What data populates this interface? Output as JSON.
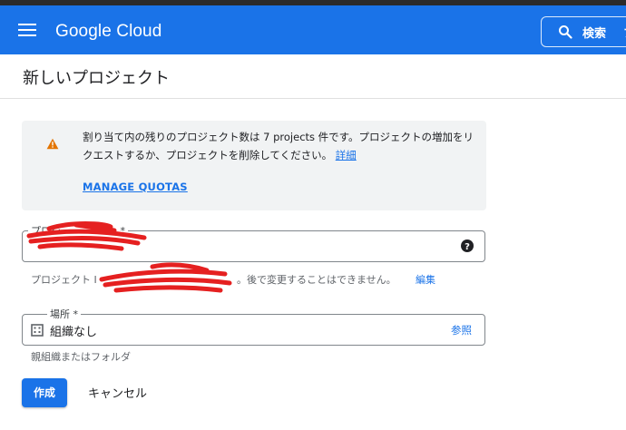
{
  "header": {
    "brand": "Google Cloud",
    "search_label": "検索",
    "search_overflow": "プ"
  },
  "page": {
    "title": "新しいプロジェクト"
  },
  "notice": {
    "message": "割り当て内の残りのプロジェクト数は 7 projects 件です。プロジェクトの増加をリクエストするか、プロジェクトを削除してください。",
    "details_link": "詳細",
    "manage_quotas": "MANAGE QUOTAS"
  },
  "project_name": {
    "label": "プロジ",
    "label_suffix": "*"
  },
  "project_id": {
    "hint_prefix": "プロジェクト I",
    "hint_suffix": "。後で変更することはできません。",
    "edit_label": "編集"
  },
  "location": {
    "label": "場所 *",
    "value": "組織なし",
    "browse_label": "参照",
    "hint": "親組織またはフォルダ"
  },
  "actions": {
    "create": "作成",
    "cancel": "キャンセル"
  },
  "colors": {
    "primary": "#1a73e8",
    "warning": "#e37400",
    "redaction": "#e52020"
  }
}
